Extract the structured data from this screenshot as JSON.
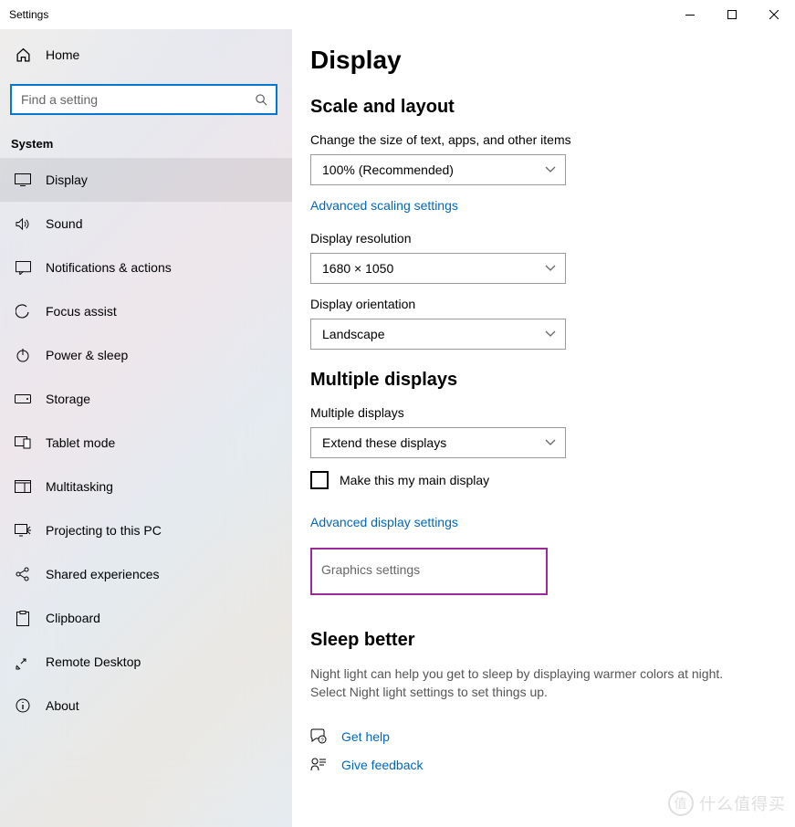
{
  "window": {
    "title": "Settings"
  },
  "home": {
    "label": "Home"
  },
  "search": {
    "placeholder": "Find a setting"
  },
  "category": "System",
  "nav": [
    {
      "label": "Display"
    },
    {
      "label": "Sound"
    },
    {
      "label": "Notifications & actions"
    },
    {
      "label": "Focus assist"
    },
    {
      "label": "Power & sleep"
    },
    {
      "label": "Storage"
    },
    {
      "label": "Tablet mode"
    },
    {
      "label": "Multitasking"
    },
    {
      "label": "Projecting to this PC"
    },
    {
      "label": "Shared experiences"
    },
    {
      "label": "Clipboard"
    },
    {
      "label": "Remote Desktop"
    },
    {
      "label": "About"
    }
  ],
  "page": {
    "title": "Display",
    "scale": {
      "heading": "Scale and layout",
      "size_label": "Change the size of text, apps, and other items",
      "size_value": "100% (Recommended)",
      "advanced_link": "Advanced scaling settings",
      "resolution_label": "Display resolution",
      "resolution_value": "1680 × 1050",
      "orientation_label": "Display orientation",
      "orientation_value": "Landscape"
    },
    "multi": {
      "heading": "Multiple displays",
      "label": "Multiple displays",
      "value": "Extend these displays",
      "checkbox": "Make this my main display",
      "advanced_link": "Advanced display settings",
      "graphics": "Graphics settings"
    },
    "sleep": {
      "heading": "Sleep better",
      "body": "Night light can help you get to sleep by displaying warmer colors at night. Select Night light settings to set things up."
    },
    "help": {
      "get_help": "Get help",
      "feedback": "Give feedback"
    }
  },
  "watermark": "什么值得买"
}
